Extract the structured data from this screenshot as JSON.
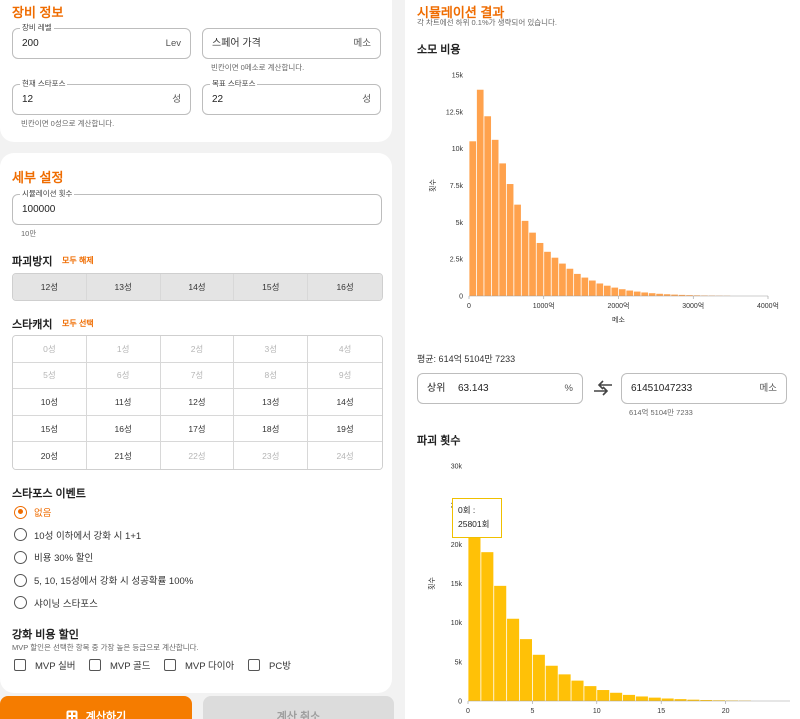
{
  "equipment": {
    "title": "장비 정보",
    "level": {
      "label": "장비 레벨",
      "value": "200",
      "unit": "Lev"
    },
    "spare_price": {
      "placeholder": "스페어 가격",
      "unit": "메소",
      "helper": "빈칸이면 0메소로 계산합니다."
    },
    "current_sf": {
      "label": "현재 스타포스",
      "value": "12",
      "unit": "성"
    },
    "target_sf": {
      "label": "목표 스타포스",
      "value": "22",
      "unit": "성"
    },
    "sf_helper": "빈칸이면 0성으로 계산합니다."
  },
  "detail": {
    "title": "세부 설정",
    "sim_count": {
      "label": "시뮬레이션 횟수",
      "value": "100000",
      "helper": "10만"
    },
    "prevent": {
      "title": "파괴방지",
      "link": "모두 해제",
      "items": [
        "12성",
        "13성",
        "14성",
        "15성",
        "16성"
      ]
    },
    "catch": {
      "title": "스타캐치",
      "link": "모두 선택",
      "items": [
        {
          "label": "0성",
          "disabled": true
        },
        {
          "label": "1성",
          "disabled": true
        },
        {
          "label": "2성",
          "disabled": true
        },
        {
          "label": "3성",
          "disabled": true
        },
        {
          "label": "4성",
          "disabled": true
        },
        {
          "label": "5성",
          "disabled": true
        },
        {
          "label": "6성",
          "disabled": true
        },
        {
          "label": "7성",
          "disabled": true
        },
        {
          "label": "8성",
          "disabled": true
        },
        {
          "label": "9성",
          "disabled": true
        },
        {
          "label": "10성",
          "disabled": false
        },
        {
          "label": "11성",
          "disabled": false
        },
        {
          "label": "12성",
          "disabled": false
        },
        {
          "label": "13성",
          "disabled": false
        },
        {
          "label": "14성",
          "disabled": false
        },
        {
          "label": "15성",
          "disabled": false
        },
        {
          "label": "16성",
          "disabled": false
        },
        {
          "label": "17성",
          "disabled": false
        },
        {
          "label": "18성",
          "disabled": false
        },
        {
          "label": "19성",
          "disabled": false
        },
        {
          "label": "20성",
          "disabled": false
        },
        {
          "label": "21성",
          "disabled": false
        },
        {
          "label": "22성",
          "disabled": true
        },
        {
          "label": "23성",
          "disabled": true
        },
        {
          "label": "24성",
          "disabled": true
        }
      ]
    },
    "event": {
      "title": "스타포스 이벤트",
      "options": [
        "없음",
        "10성 이하에서 강화 시 1+1",
        "비용 30% 할인",
        "5, 10, 15성에서 강화 시 성공확률 100%",
        "샤이닝 스타포스"
      ],
      "selected": 0
    },
    "discount": {
      "title": "강화 비용 할인",
      "helper": "MVP 할인은 선택한 항목 중 가장 높은 등급으로 계산합니다.",
      "options": [
        "MVP 실버",
        "MVP 골드",
        "MVP 다이아",
        "PC방"
      ]
    }
  },
  "buttons": {
    "calculate": "계산하기",
    "cancel": "계산 취소"
  },
  "result": {
    "title": "시뮬레이션 결과",
    "subtitle": "각 차트에선 하위 0.1%가 생략되어 있습니다.",
    "cost_title": "소모 비용",
    "average": "평균: 614억 5104만 7233",
    "percentile": {
      "label": "상위",
      "value": "63.143",
      "unit": "%"
    },
    "meso": {
      "value": "61451047233",
      "unit": "메소",
      "helper": "614억 5104만 7233"
    },
    "destroy_title": "파괴 횟수",
    "tooltip": {
      "line1": "0회 :",
      "line2": "25801회"
    }
  },
  "colors": {
    "accent": "#ef6c00",
    "cost_bar": "#ffa24d",
    "destroy_bar": "#ffc107"
  },
  "icons": {
    "swap": "swap-arrows-icon",
    "calculator": "calculator-icon"
  },
  "chart_data": [
    {
      "type": "bar",
      "title": "소모 비용",
      "xlabel": "메소",
      "ylabel": "횟수",
      "xlim": [
        0,
        4000
      ],
      "ylim": [
        0,
        15000
      ],
      "x_ticks": [
        0,
        1000,
        2000,
        3000,
        4000
      ],
      "x_tick_labels": [
        "0",
        "1000억",
        "2000억",
        "3000억",
        "4000억"
      ],
      "y_ticks": [
        0,
        2500,
        5000,
        7500,
        10000,
        12500,
        15000
      ],
      "y_tick_labels": [
        "0",
        "2.5k",
        "5k",
        "7.5k",
        "10k",
        "12.5k",
        "15k"
      ],
      "bin_width": 100,
      "bin_starts": [
        0,
        100,
        200,
        300,
        400,
        500,
        600,
        700,
        800,
        900,
        1000,
        1100,
        1200,
        1300,
        1400,
        1500,
        1600,
        1700,
        1800,
        1900,
        2000,
        2100,
        2200,
        2300,
        2400,
        2500,
        2600,
        2700,
        2800,
        2900,
        3000,
        3100,
        3200,
        3300,
        3400
      ],
      "values": [
        10500,
        14000,
        12200,
        10600,
        9000,
        7600,
        6200,
        5100,
        4300,
        3600,
        3000,
        2600,
        2200,
        1850,
        1500,
        1250,
        1050,
        850,
        700,
        570,
        460,
        370,
        300,
        240,
        190,
        150,
        120,
        95,
        75,
        58,
        45,
        35,
        27,
        20,
        15
      ],
      "grid": false
    },
    {
      "type": "bar",
      "title": "파괴 횟수",
      "ylabel": "횟수",
      "xlim": [
        0,
        25
      ],
      "ylim": [
        0,
        30000
      ],
      "x_ticks": [
        0,
        5,
        10,
        15,
        20
      ],
      "x_tick_labels": [
        "0",
        "5",
        "10",
        "15",
        "20"
      ],
      "y_ticks": [
        0,
        5000,
        10000,
        15000,
        20000,
        25000,
        30000
      ],
      "y_tick_labels": [
        "0",
        "5k",
        "10k",
        "15k",
        "20k",
        "25k",
        "30k"
      ],
      "categories": [
        0,
        1,
        2,
        3,
        4,
        5,
        6,
        7,
        8,
        9,
        10,
        11,
        12,
        13,
        14,
        15,
        16,
        17,
        18,
        19,
        20,
        21
      ],
      "values": [
        25801,
        19000,
        14700,
        10500,
        7900,
        5900,
        4500,
        3400,
        2600,
        1900,
        1400,
        1050,
        780,
        580,
        430,
        320,
        240,
        170,
        125,
        90,
        65,
        45
      ],
      "grid": false
    }
  ]
}
